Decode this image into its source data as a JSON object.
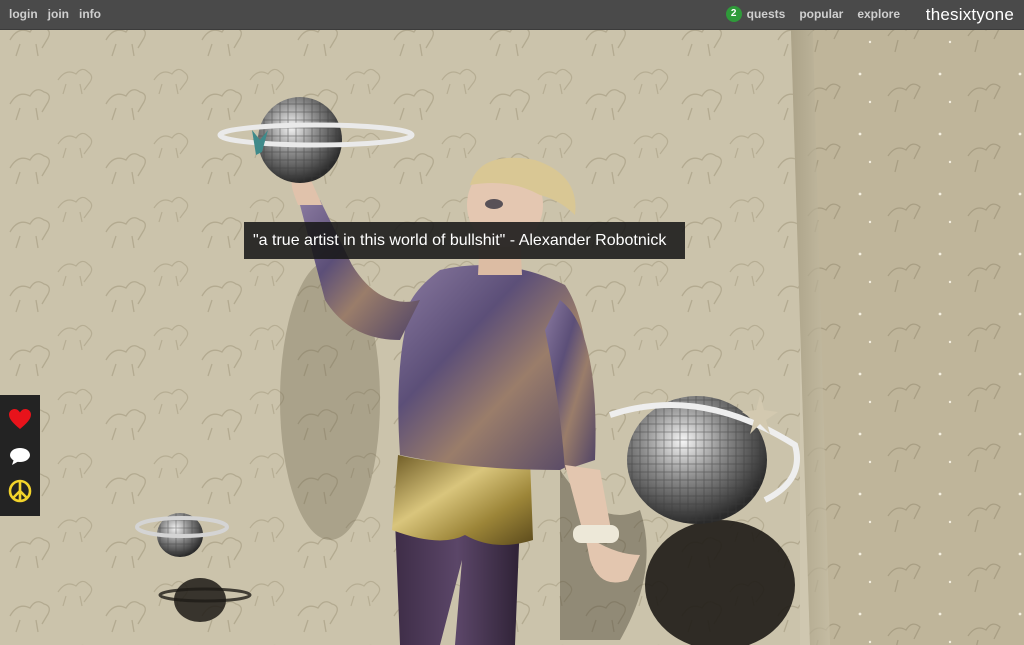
{
  "topbar": {
    "left_links": [
      {
        "label": "login"
      },
      {
        "label": "join"
      },
      {
        "label": "info"
      }
    ],
    "quests": {
      "count": "2",
      "label": "quests"
    },
    "right_links": [
      {
        "label": "popular"
      },
      {
        "label": "explore"
      }
    ],
    "brand": "thesixtyone"
  },
  "caption": {
    "text": "\"a true artist in this world of bullshit\" - Alexander Robotnick"
  },
  "sidebar": {
    "buttons": [
      {
        "icon": "heart-icon",
        "color": "#e8131b"
      },
      {
        "icon": "comment-icon",
        "color": "#ffffff"
      },
      {
        "icon": "peace-icon",
        "color": "#f2d32b"
      }
    ]
  },
  "colors": {
    "topbar_bg": "#4a4a4a",
    "quest_badge": "#2f9a3a",
    "caption_bg": "#181818"
  }
}
